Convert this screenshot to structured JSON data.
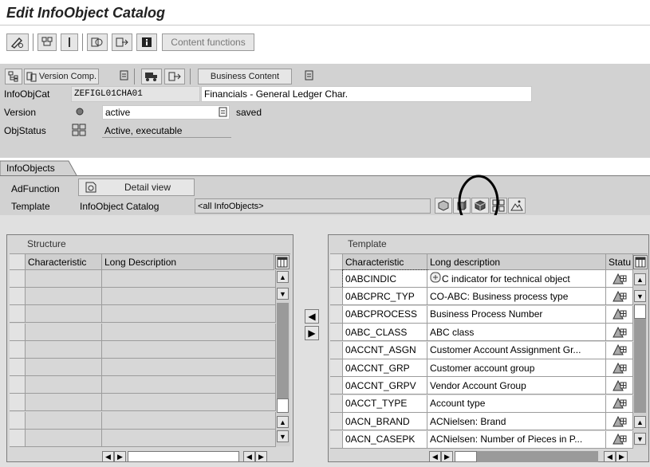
{
  "window": {
    "title": "Edit InfoObject Catalog"
  },
  "toolbar": {
    "content_functions": "Content functions"
  },
  "subtoolbar": {
    "version_comp": "Version Comp.",
    "business_content": "Business Content"
  },
  "header": {
    "infoobjcat_label": "InfoObjCat",
    "infoobjcat_value": "ZEFIGL01CHA01",
    "infoobjcat_desc": "Financials - General Ledger Char.",
    "version_label": "Version",
    "version_value": "active",
    "version_status": "saved",
    "objstatus_label": "ObjStatus",
    "objstatus_value": "Active, executable"
  },
  "tab": {
    "label": "InfoObjects"
  },
  "controls": {
    "adfunction_label": "AdFunction",
    "detail_view": "Detail view",
    "template_label": "Template",
    "template_value": "InfoObject Catalog",
    "template_select": "<all InfoObjects>"
  },
  "structure": {
    "title": "Structure",
    "columns": [
      "Characteristic",
      "Long Description"
    ],
    "row_count": 10
  },
  "template": {
    "title": "Template",
    "columns": [
      "Characteristic",
      "Long description",
      "Statu"
    ],
    "rows": [
      {
        "char": "0ABCINDIC",
        "desc": "C indicator for technical object"
      },
      {
        "char": "0ABCPRC_TYP",
        "desc": "CO-ABC: Business process type"
      },
      {
        "char": "0ABCPROCESS",
        "desc": "Business Process Number"
      },
      {
        "char": "0ABC_CLASS",
        "desc": "ABC class"
      },
      {
        "char": "0ACCNT_ASGN",
        "desc": "Customer Account Assignment Gr..."
      },
      {
        "char": "0ACCNT_GRP",
        "desc": "Customer account group"
      },
      {
        "char": "0ACCNT_GRPV",
        "desc": "Vendor Account Group"
      },
      {
        "char": "0ACCT_TYPE",
        "desc": "Account type"
      },
      {
        "char": "0ACN_BRAND",
        "desc": "ACNielsen: Brand"
      },
      {
        "char": "0ACN_CASEPK",
        "desc": "ACNielsen: Number of Pieces in P..."
      }
    ]
  }
}
